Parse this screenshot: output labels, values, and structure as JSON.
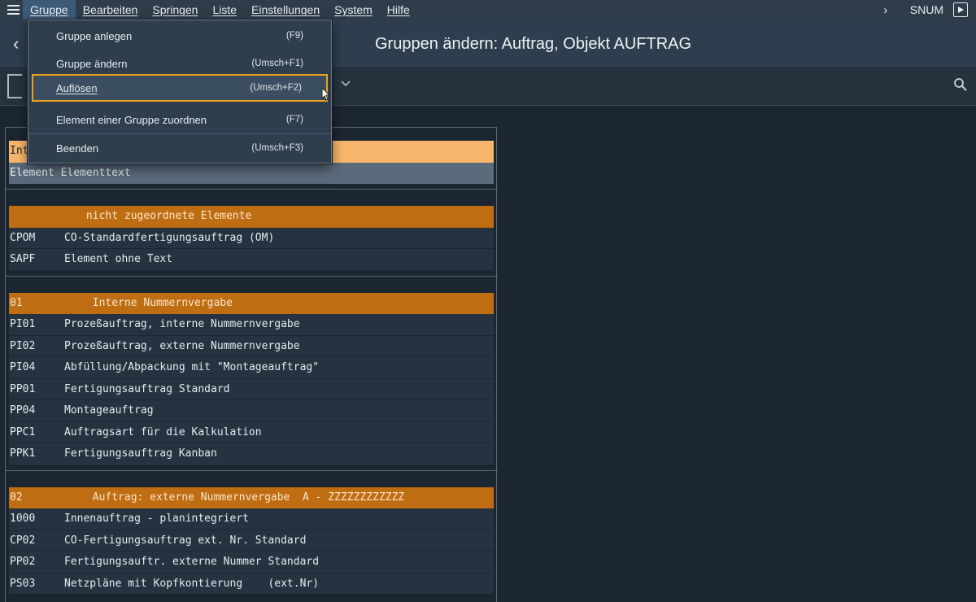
{
  "menubar": {
    "items": [
      {
        "label": "Gruppe"
      },
      {
        "label": "Bearbeiten"
      },
      {
        "label": "Springen"
      },
      {
        "label": "Liste"
      },
      {
        "label": "Einstellungen"
      },
      {
        "label": "System"
      },
      {
        "label": "Hilfe"
      }
    ],
    "system_id": "SNUM"
  },
  "title": "Gruppen ändern: Auftrag, Objekt AUFTRAG",
  "dropdown": [
    {
      "label": "Gruppe anlegen",
      "shortcut": "(F9)"
    },
    {
      "label": "Gruppe ändern",
      "shortcut": "(Umsch+F1)"
    },
    {
      "label": "Auflösen",
      "shortcut": "(Umsch+F2)"
    },
    {
      "label": "Element einer Gruppe zuordnen",
      "shortcut": "(F7)"
    },
    {
      "label": "Beenden",
      "shortcut": "(Umsch+F3)"
    }
  ],
  "list": {
    "header_partial": "Int",
    "subheader": "Element Elementtext",
    "groups": [
      {
        "title": "            nicht zugeordnete Elemente",
        "rows": [
          {
            "code": "CPOM",
            "text": "CO-Standardfertigungsauftrag (OM)"
          },
          {
            "code": "SAPF",
            "text": "Element ohne Text"
          }
        ]
      },
      {
        "title": "01           Interne Nummernvergabe",
        "rows": [
          {
            "code": "PI01",
            "text": "Prozeßauftrag, interne Nummernvergabe"
          },
          {
            "code": "PI02",
            "text": "Prozeßauftrag, externe Nummernvergabe"
          },
          {
            "code": "PI04",
            "text": "Abfüllung/Abpackung mit \"Montageauftrag\""
          },
          {
            "code": "PP01",
            "text": "Fertigungsauftrag Standard"
          },
          {
            "code": "PP04",
            "text": "Montageauftrag"
          },
          {
            "code": "PPC1",
            "text": "Auftragsart für die Kalkulation"
          },
          {
            "code": "PPK1",
            "text": "Fertigungsauftrag Kanban"
          }
        ]
      },
      {
        "title": "02           Auftrag: externe Nummernvergabe  A - ZZZZZZZZZZZZ",
        "rows": [
          {
            "code": "1000",
            "text": "Innenauftrag - planintegriert"
          },
          {
            "code": "CP02",
            "text": "CO-Fertigungsauftrag ext. Nr. Standard"
          },
          {
            "code": "PP02",
            "text": "Fertigungsauftr. externe Nummer Standard"
          },
          {
            "code": "PS03",
            "text": "Netzpläne mit Kopfkontierung    (ext.Nr)"
          }
        ]
      }
    ]
  },
  "icons": {
    "menu": "hamburger-icon",
    "back": "chevron-left-icon",
    "expand": "chevron-right-icon",
    "run": "play-icon",
    "search": "search-icon",
    "dropdown": "chevron-down-icon"
  },
  "colors": {
    "accent_selection": "#e9a21d",
    "group_header": "#bf6d12",
    "highlight_row": "#f7b66b"
  }
}
